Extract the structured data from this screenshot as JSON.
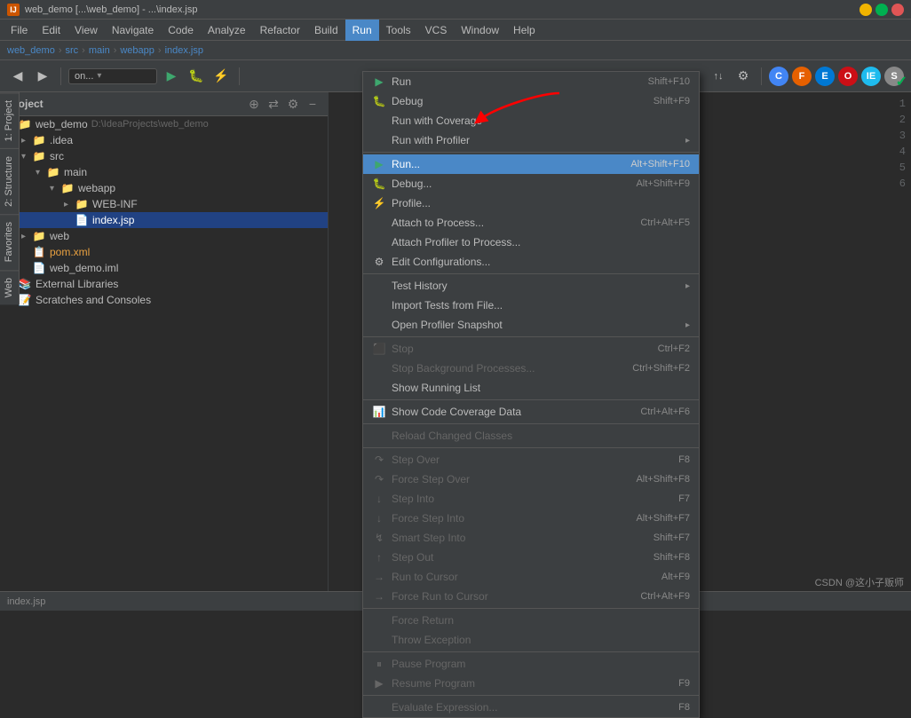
{
  "titleBar": {
    "appName": "IntelliJ IDEA",
    "projectName": "web_demo [...\\web_demo] - ...\\index.jsp",
    "windowControls": [
      "minimize",
      "maximize",
      "close"
    ]
  },
  "menuBar": {
    "items": [
      {
        "id": "file",
        "label": "File"
      },
      {
        "id": "edit",
        "label": "Edit"
      },
      {
        "id": "view",
        "label": "View"
      },
      {
        "id": "navigate",
        "label": "Navigate"
      },
      {
        "id": "code",
        "label": "Code"
      },
      {
        "id": "analyze",
        "label": "Analyze"
      },
      {
        "id": "refactor",
        "label": "Refactor"
      },
      {
        "id": "build",
        "label": "Build"
      },
      {
        "id": "run",
        "label": "Run",
        "active": true
      },
      {
        "id": "tools",
        "label": "Tools"
      },
      {
        "id": "vcs",
        "label": "VCS"
      },
      {
        "id": "window",
        "label": "Window"
      },
      {
        "id": "help",
        "label": "Help"
      }
    ]
  },
  "breadcrumb": {
    "items": [
      "web_demo",
      "src",
      "main",
      "webapp",
      "index.jsp"
    ]
  },
  "sidebar": {
    "title": "Project",
    "tree": [
      {
        "id": "web_demo_root",
        "label": "web_demo",
        "extra": "D:\\IdeaProjects\\web_demo",
        "indent": 0,
        "type": "project",
        "expanded": true
      },
      {
        "id": "idea",
        "label": ".idea",
        "indent": 1,
        "type": "folder",
        "expanded": false
      },
      {
        "id": "src",
        "label": "src",
        "indent": 1,
        "type": "folder",
        "expanded": true
      },
      {
        "id": "main",
        "label": "main",
        "indent": 2,
        "type": "folder",
        "expanded": true
      },
      {
        "id": "webapp",
        "label": "webapp",
        "indent": 3,
        "type": "folder",
        "expanded": true
      },
      {
        "id": "webinf",
        "label": "WEB-INF",
        "indent": 4,
        "type": "folder",
        "expanded": false
      },
      {
        "id": "indexjsp",
        "label": "index.jsp",
        "indent": 4,
        "type": "jsp",
        "selected": true
      },
      {
        "id": "web",
        "label": "web",
        "indent": 1,
        "type": "folder",
        "expanded": false
      },
      {
        "id": "pomxml",
        "label": "pom.xml",
        "indent": 1,
        "type": "xml"
      },
      {
        "id": "web_demo_iml",
        "label": "web_demo.iml",
        "indent": 1,
        "type": "iml"
      },
      {
        "id": "ext_libs",
        "label": "External Libraries",
        "indent": 0,
        "type": "lib",
        "expanded": false
      },
      {
        "id": "scratches",
        "label": "Scratches and Consoles",
        "indent": 0,
        "type": "scratch",
        "expanded": false
      }
    ]
  },
  "runMenu": {
    "items": [
      {
        "id": "run_simple",
        "label": "Run",
        "shortcut": "Shift+F10",
        "icon": "▶",
        "enabled": true
      },
      {
        "id": "debug",
        "label": "Debug",
        "shortcut": "Shift+F9",
        "icon": "🐛",
        "enabled": true
      },
      {
        "id": "run_coverage",
        "label": "Run with Coverage",
        "shortcut": "",
        "icon": "",
        "enabled": true
      },
      {
        "id": "run_profiler",
        "label": "Run with Profiler",
        "shortcut": "",
        "icon": "",
        "hasSubmenu": true,
        "enabled": true
      },
      {
        "id": "run_dots",
        "label": "Run...",
        "shortcut": "Alt+Shift+F10",
        "icon": "▶",
        "highlighted": true,
        "enabled": true
      },
      {
        "id": "debug_dots",
        "label": "Debug...",
        "shortcut": "Alt+Shift+F9",
        "icon": "🐛",
        "enabled": true
      },
      {
        "id": "profile_dots",
        "label": "Profile...",
        "shortcut": "",
        "icon": "",
        "enabled": true
      },
      {
        "id": "attach_process",
        "label": "Attach to Process...",
        "shortcut": "Ctrl+Alt+F5",
        "icon": "",
        "enabled": true
      },
      {
        "id": "attach_profiler",
        "label": "Attach Profiler to Process...",
        "shortcut": "",
        "icon": "",
        "enabled": true
      },
      {
        "id": "edit_configs",
        "label": "Edit Configurations...",
        "shortcut": "",
        "icon": "",
        "enabled": true
      },
      {
        "sep1": true
      },
      {
        "id": "test_history",
        "label": "Test History",
        "shortcut": "",
        "icon": "",
        "hasSubmenu": true,
        "enabled": true
      },
      {
        "id": "import_tests",
        "label": "Import Tests from File...",
        "shortcut": "",
        "icon": "",
        "enabled": true
      },
      {
        "id": "open_profiler_snapshot",
        "label": "Open Profiler Snapshot",
        "shortcut": "",
        "icon": "",
        "hasSubmenu": true,
        "enabled": true
      },
      {
        "sep2": true
      },
      {
        "id": "stop",
        "label": "Stop",
        "shortcut": "Ctrl+F2",
        "icon": "⬛",
        "enabled": false
      },
      {
        "id": "stop_background",
        "label": "Stop Background Processes...",
        "shortcut": "Ctrl+Shift+F2",
        "icon": "",
        "enabled": false
      },
      {
        "id": "show_running",
        "label": "Show Running List",
        "shortcut": "",
        "icon": "",
        "enabled": true
      },
      {
        "sep3": true
      },
      {
        "id": "show_coverage",
        "label": "Show Code Coverage Data",
        "shortcut": "Ctrl+Alt+F6",
        "icon": "",
        "enabled": true
      },
      {
        "sep4": true
      },
      {
        "id": "reload_classes",
        "label": "Reload Changed Classes",
        "shortcut": "",
        "icon": "",
        "enabled": false
      },
      {
        "sep5": true
      },
      {
        "id": "step_over",
        "label": "Step Over",
        "shortcut": "F8",
        "icon": "↷",
        "enabled": false
      },
      {
        "id": "force_step_over",
        "label": "Force Step Over",
        "shortcut": "Alt+Shift+F8",
        "icon": "↷↷",
        "enabled": false
      },
      {
        "id": "step_into",
        "label": "Step Into",
        "shortcut": "F7",
        "icon": "↓",
        "enabled": false
      },
      {
        "id": "force_step_into",
        "label": "Force Step Into",
        "shortcut": "Alt+Shift+F7",
        "icon": "↓↓",
        "enabled": false
      },
      {
        "id": "smart_step_into",
        "label": "Smart Step Into",
        "shortcut": "Shift+F7",
        "icon": "↯",
        "enabled": false
      },
      {
        "id": "step_out",
        "label": "Step Out",
        "shortcut": "Shift+F8",
        "icon": "↑",
        "enabled": false
      },
      {
        "id": "run_to_cursor",
        "label": "Run to Cursor",
        "shortcut": "Alt+F9",
        "icon": "→",
        "enabled": false
      },
      {
        "id": "force_run_cursor",
        "label": "Force Run to Cursor",
        "shortcut": "Ctrl+Alt+F9",
        "icon": "→→",
        "enabled": false
      },
      {
        "sep6": true
      },
      {
        "id": "force_return",
        "label": "Force Return",
        "shortcut": "",
        "icon": "",
        "enabled": false
      },
      {
        "id": "throw_exception",
        "label": "Throw Exception",
        "shortcut": "",
        "icon": "",
        "enabled": false
      },
      {
        "sep7": true
      },
      {
        "id": "pause_program",
        "label": "Pause Program",
        "shortcut": "",
        "icon": "⏸",
        "enabled": false
      },
      {
        "id": "resume_program",
        "label": "Resume Program",
        "shortcut": "F9",
        "icon": "▶",
        "enabled": false
      },
      {
        "sep8": true
      },
      {
        "id": "eval_expr",
        "label": "Evaluate Expression...",
        "shortcut": "F8",
        "icon": "",
        "enabled": false
      }
    ]
  },
  "verticalTabs": {
    "left": [
      "1: Project",
      "2: Structure",
      "Favorites",
      "Web"
    ],
    "right": []
  },
  "editorLines": [
    "1",
    "2",
    "3",
    "4",
    "5",
    "6"
  ],
  "watermark": "CSDN @这小子贩师",
  "checkmark": "✓"
}
